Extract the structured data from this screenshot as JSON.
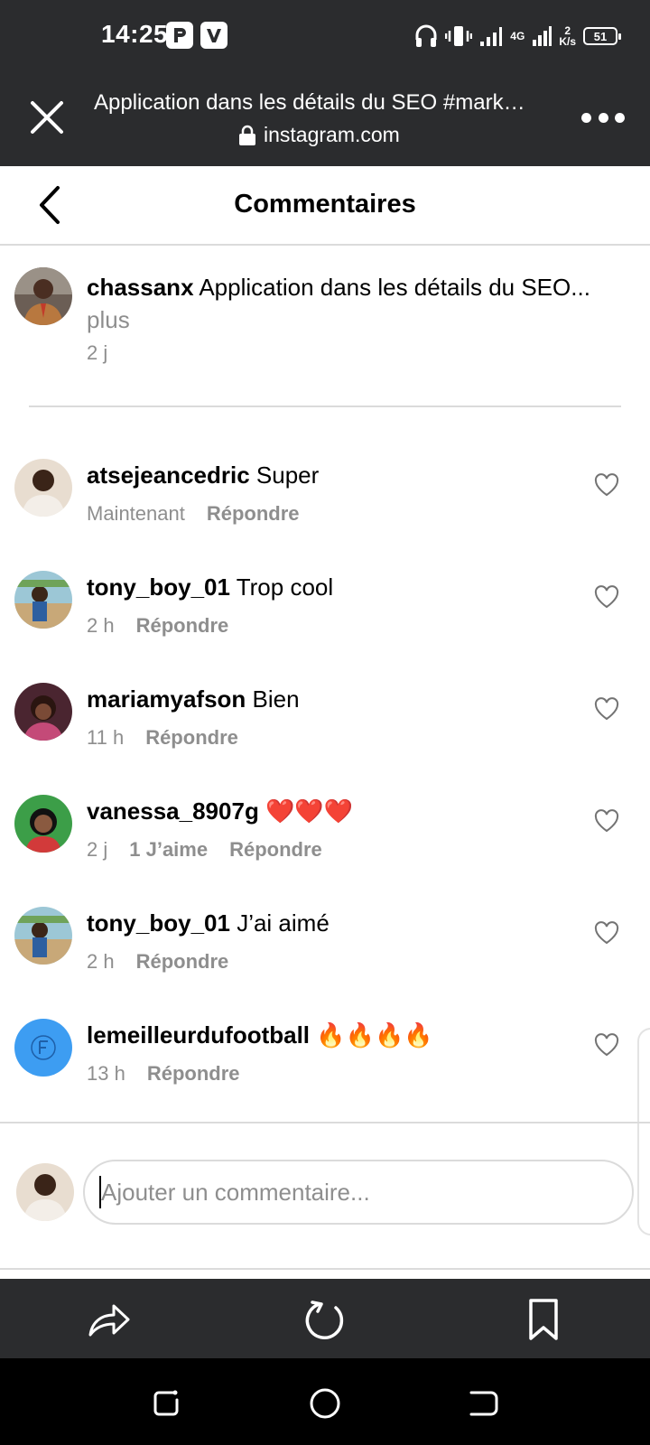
{
  "status_bar": {
    "time": "14:25",
    "network_type": "4G",
    "speed_value": "2",
    "speed_unit": "K/s",
    "battery": "51"
  },
  "browser": {
    "page_title": "Application dans les détails du SEO #mark…",
    "domain": "instagram.com"
  },
  "header": {
    "title": "Commentaires"
  },
  "caption": {
    "username": "chassanx",
    "text": "Application dans les détails du SEO...",
    "more_label": "plus",
    "time": "2 j"
  },
  "comments": [
    {
      "username": "atsejeancedric",
      "text": "Super",
      "time": "Maintenant",
      "likes": "",
      "reply_label": "Répondre",
      "avatar_color": "#d9c3a5"
    },
    {
      "username": "tony_boy_01",
      "text": "Trop cool",
      "time": "2 h",
      "likes": "",
      "reply_label": "Répondre",
      "avatar_color": "#8fb7c9"
    },
    {
      "username": "mariamyafson",
      "text": "Bien",
      "time": "11 h",
      "likes": "",
      "reply_label": "Répondre",
      "avatar_color": "#5a2f3b"
    },
    {
      "username": "vanessa_8907g",
      "text": "❤️❤️❤️",
      "time": "2 j",
      "likes": "1 J’aime",
      "reply_label": "Répondre",
      "avatar_color": "#2f8f3a"
    },
    {
      "username": "tony_boy_01",
      "text": "J’ai aimé",
      "time": "2 h",
      "likes": "",
      "reply_label": "Répondre",
      "avatar_color": "#8fb7c9"
    },
    {
      "username": "lemeilleurdufootball",
      "text": "🔥🔥🔥🔥",
      "time": "13 h",
      "likes": "",
      "reply_label": "Répondre",
      "avatar_color": "#3d9df2"
    }
  ],
  "composer": {
    "placeholder": "Ajouter un commentaire..."
  },
  "colors": {
    "dark_chrome": "#2b2c2e",
    "muted_text": "#8e8e8e",
    "divider": "#dbdbdb"
  }
}
